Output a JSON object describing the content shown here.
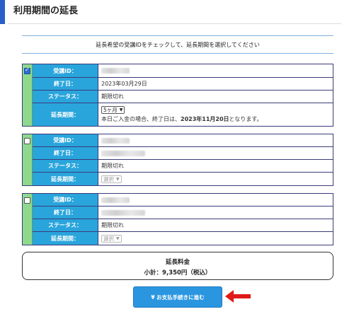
{
  "page": {
    "title": "利用期間の延長"
  },
  "instruction": "延長希望の受講IDをチェックして、延長期間を選択してください",
  "labels": {
    "id": "受講ID：",
    "end_date": "終了日：",
    "status": "ステータス：",
    "period": "延長期間："
  },
  "cards": [
    {
      "checked": true,
      "end_date": "2023年03月29日",
      "status": "期限切れ",
      "period_selected": "5ヶ月",
      "note": "本日ご入金の場合、終了日は、2023年11月20日となります。",
      "note_prefix": "本日ご入金の場合、終了日は、",
      "note_date": "2023年11月20日",
      "note_suffix": "となります。"
    },
    {
      "checked": false,
      "status": "期限切れ",
      "period_selected": "選択"
    },
    {
      "checked": false,
      "status": "期限切れ",
      "period_selected": "選択"
    }
  ],
  "fee": {
    "title": "延長料金",
    "subtotal": "小計：9,350円（税込）"
  },
  "pay_button": {
    "label": "¥ お支払手続きに進む"
  },
  "colors": {
    "accent": "#2a5fc9",
    "label_bg": "#29a5dc",
    "check_col": "#8ed98e",
    "button": "#2b96e0",
    "arrow": "#e01919"
  }
}
